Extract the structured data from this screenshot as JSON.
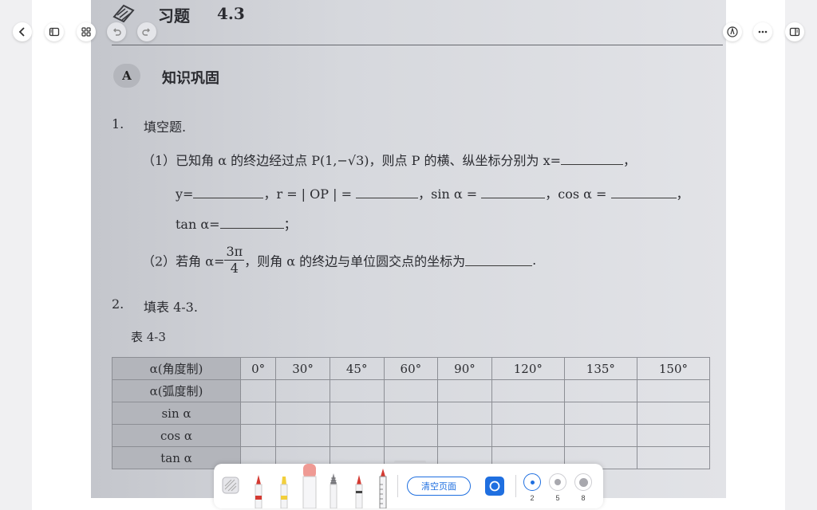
{
  "header": {
    "title": "习题",
    "number": "4.3"
  },
  "section": {
    "badge": "A",
    "title": "知识巩固"
  },
  "q1": {
    "number": "1.",
    "title": "填空题.",
    "p1_prefix": "（1）已知角 α 的终边经过点 P(1,−√3)，则点 P 的横、纵坐标分别为 x=",
    "p1_comma": "，",
    "p1_line2_y": "y=",
    "p1_line2_r": "，r = | OP | =",
    "p1_line2_sin": "，sin  α =",
    "p1_line2_cos": "，cos  α =",
    "p1_line3_tan": "tan α=",
    "p1_semicolon": "；",
    "p2_prefix": "（2）若角 α=",
    "p2_num": "3π",
    "p2_den": "4",
    "p2_suffix": "，则角 α 的终边与单位圆交点的坐标为",
    "p2_period": "."
  },
  "q2": {
    "number": "2.",
    "title": "填表 4-3.",
    "table_caption": "表 4-3"
  },
  "table": {
    "rows": [
      "α(角度制)",
      "α(弧度制)",
      "sin α",
      "cos α",
      "tan α"
    ],
    "columns": [
      "0°",
      "30°",
      "45°",
      "60°",
      "90°",
      "120°",
      "135°",
      "150°"
    ]
  },
  "toolbar_bottom": {
    "clear_label": "清空页面",
    "sizes": [
      "2",
      "5",
      "8"
    ],
    "selected_size": "2"
  },
  "colors": {
    "accent": "#1f6fe0",
    "pen_red": "#d43a32",
    "pen_yellow": "#f2cf3c",
    "eraser_pink": "#ef9a94"
  }
}
